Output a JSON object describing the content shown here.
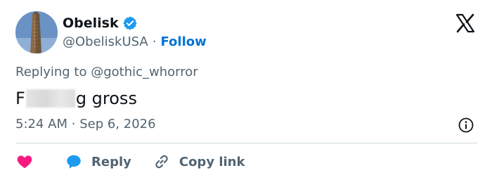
{
  "author": {
    "display_name": "Obelisk",
    "handle": "@ObeliskUSA",
    "separator": "·",
    "follow_label": "Follow",
    "verified_color": "#1d9bf0"
  },
  "reply_context": {
    "prefix": "Replying to ",
    "mention": "@gothic_whorror"
  },
  "tweet": {
    "text_start": "F",
    "text_end": "g gross",
    "censored": true
  },
  "timestamp": {
    "time": "5:24 AM",
    "separator": "·",
    "date": "Sep 6, 2026"
  },
  "actions": {
    "reply_label": "Reply",
    "copy_label": "Copy link"
  },
  "colors": {
    "like": "#f91880",
    "reply_bubble": "#1d9bf0",
    "follow_link": "#0074d4",
    "secondary_text": "#536471"
  },
  "icons": {
    "brand": "x-logo-icon",
    "verified": "verified-badge-icon",
    "info": "info-icon",
    "like": "heart-icon",
    "reply": "speech-bubble-icon",
    "copy": "link-icon"
  }
}
